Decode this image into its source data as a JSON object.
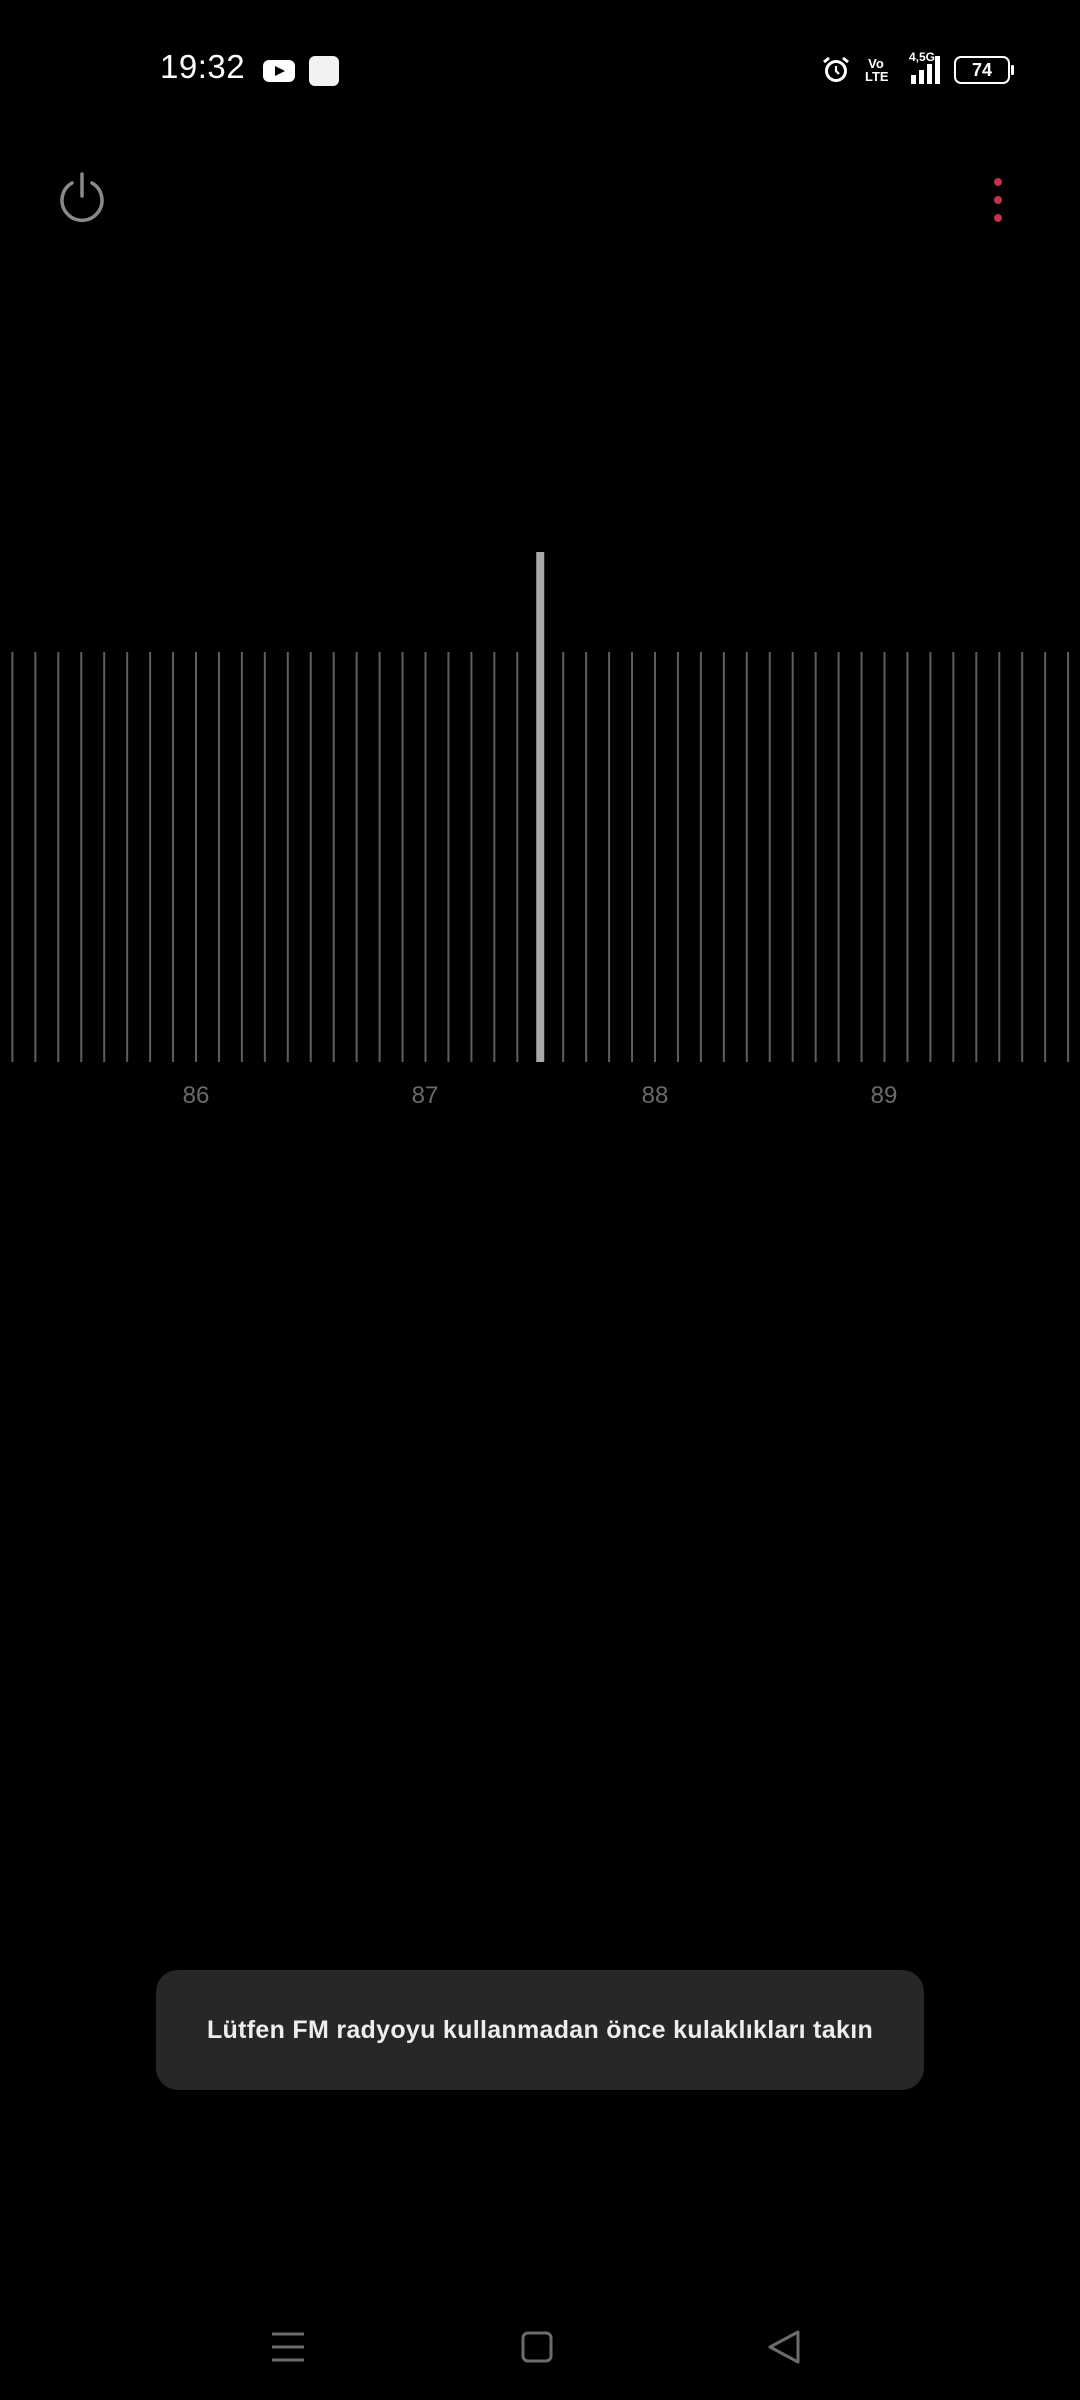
{
  "status_bar": {
    "time": "19:32",
    "network": "4,5G",
    "volte_top": "Vo",
    "volte_bottom": "LTE",
    "battery": "74",
    "icons": [
      "youtube-icon",
      "app-notification-icon",
      "alarm-icon",
      "volte-icon",
      "signal-icon",
      "battery-icon"
    ]
  },
  "app_bar": {
    "power_icon": "power-icon",
    "menu_icon": "more-vertical-icon",
    "accent_color": "#c4334a"
  },
  "tuner": {
    "labels": [
      "86",
      "87",
      "88",
      "89"
    ],
    "needle_frequency": 87.5,
    "tick_step": 0.1
  },
  "toast": {
    "message": "Lütfen FM radyoyu kullanmadan önce kulaklıkları takın"
  },
  "nav_bar": {
    "icons": [
      "recents-icon",
      "home-icon",
      "back-icon"
    ]
  }
}
